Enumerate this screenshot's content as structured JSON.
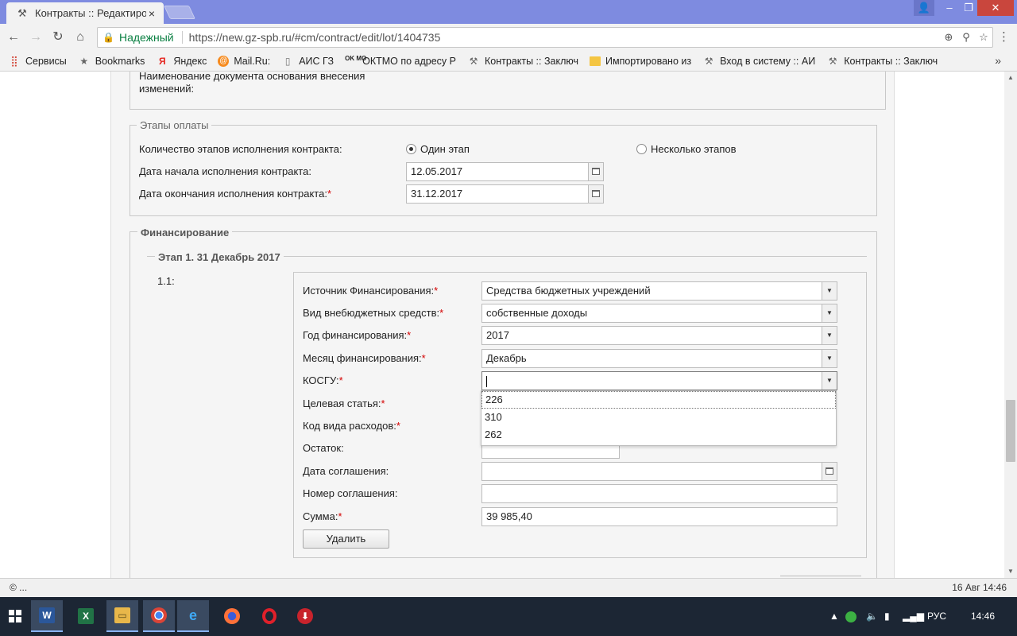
{
  "browser": {
    "tab_title": "Контракты :: Редактиров",
    "tab_close": "×",
    "secure_label": "Надежный",
    "url": "https://new.gz-spb.ru/#cm/contract/edit/lot/1404735",
    "bookmarks": [
      {
        "icon": "apps-icon",
        "glyph": "⣿",
        "label": "Сервисы",
        "cls": "bm-apps"
      },
      {
        "icon": "star-icon",
        "glyph": "★",
        "label": "Bookmarks",
        "cls": "bm-star"
      },
      {
        "icon": "yandex-icon",
        "glyph": "Я",
        "label": "Яндекс",
        "cls": "bm-ya"
      },
      {
        "icon": "mailru-icon",
        "glyph": "@",
        "label": "Mail.Ru:",
        "cls": "bm-mail"
      },
      {
        "icon": "document-icon",
        "glyph": "▯",
        "label": "АИС ГЗ",
        "cls": "bm-doc"
      },
      {
        "icon": "oktmo-icon",
        "glyph": "OK MO",
        "label": "ОКТМО по адресу Р",
        "cls": "bm-oktmo"
      },
      {
        "icon": "tools-icon",
        "glyph": "⚒",
        "label": "Контракты :: Заключ",
        "cls": "bm-tool"
      },
      {
        "icon": "folder-icon",
        "glyph": "",
        "label": "Импортировано из",
        "cls": "bm-folder"
      },
      {
        "icon": "tools-icon",
        "glyph": "⚒",
        "label": "Вход в систему :: АИ",
        "cls": "bm-tool"
      },
      {
        "icon": "tools-icon",
        "glyph": "⚒",
        "label": "Контракты :: Заключ",
        "cls": "bm-tool"
      }
    ]
  },
  "form": {
    "doc_basis_label": "Наименование документа основания внесения изменений:",
    "payment_stages": {
      "legend": "Этапы оплаты",
      "count_label": "Количество этапов исполнения контракта:",
      "option_one": "Один этап",
      "option_many": "Несколько этапов",
      "start_label": "Дата начала исполнения контракта:",
      "start_value": "12.05.2017",
      "end_label": "Дата окончания исполнения контракта:",
      "end_value": "31.12.2017",
      "required_mark": "*"
    },
    "financing": {
      "legend": "Финансирование",
      "stage_legend": "Этап 1. 31 Декабрь 2017",
      "item_number": "1.1:",
      "fields": {
        "source_label": "Источник Финансирования:",
        "source_value": "Средства бюджетных учреждений",
        "extra_label": "Вид внебюджетных средств:",
        "extra_value": "собственные доходы",
        "year_label": "Год финансирования:",
        "year_value": "2017",
        "month_label": "Месяц финансирования:",
        "month_value": "Декабрь",
        "kosgu_label": "КОСГУ:",
        "kosgu_value": "",
        "target_label": "Целевая статья:",
        "expense_label": "Код вида расходов:",
        "remainder_label": "Остаток:",
        "agreement_date_label": "Дата соглашения:",
        "agreement_number_label": "Номер соглашения:",
        "sum_label": "Сумма:",
        "sum_value": "39 985,40"
      },
      "kosgu_options": [
        "226",
        "310",
        "262"
      ],
      "delete_button": "Удалить"
    }
  },
  "status": {
    "left": "© ...",
    "right": "16 Авг 14:46"
  },
  "taskbar": {
    "lang": "РУС",
    "time": "14:46"
  }
}
